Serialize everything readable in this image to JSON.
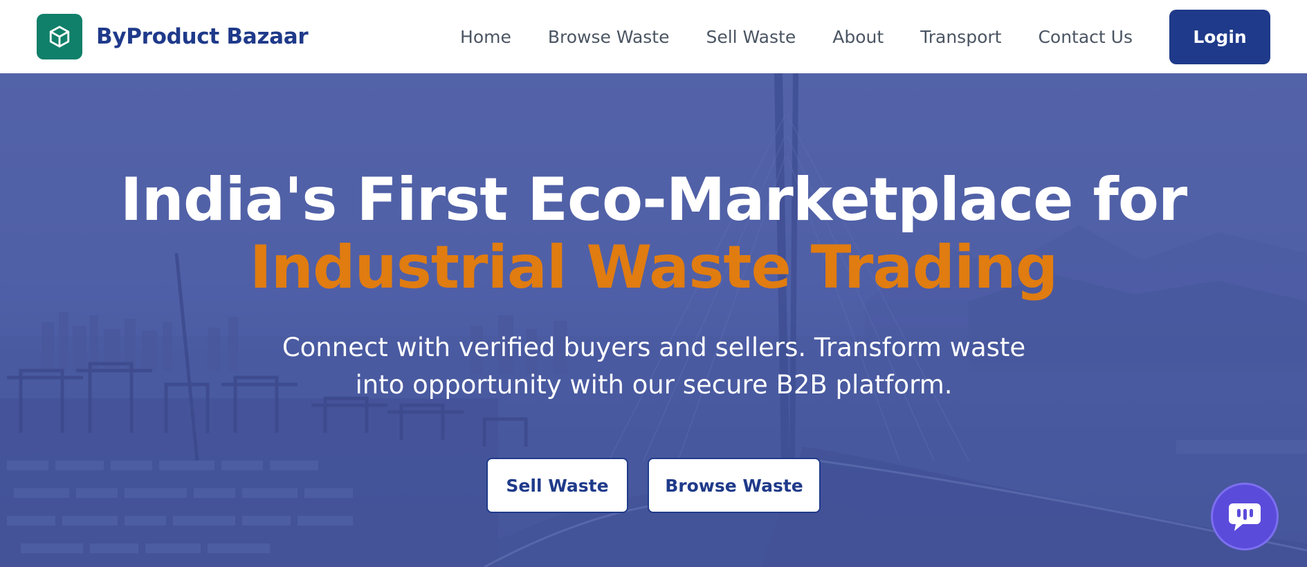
{
  "brand": {
    "name": "ByProduct Bazaar",
    "logo_icon": "cube-icon",
    "logo_color": "#10806a"
  },
  "nav": {
    "links": [
      "Home",
      "Browse Waste",
      "Sell Waste",
      "About",
      "Transport",
      "Contact Us"
    ],
    "login_label": "Login"
  },
  "hero": {
    "title_line1": "India's First Eco-Marketplace for",
    "title_line2": "Industrial Waste Trading",
    "subtitle": "Connect with verified buyers and sellers. Transform waste into opportunity with our secure B2B platform.",
    "sell_button": "Sell Waste",
    "browse_button": "Browse Waste",
    "background": "industrial port with cranes, shipping containers and a cable-stayed bridge"
  },
  "chat": {
    "icon": "chat-bubble-icon"
  },
  "colors": {
    "primary": "#1f3a8a",
    "accent": "#e07c10",
    "brand_green": "#10806a",
    "chat": "#5b4bdb",
    "hero_tint": "#5464a8"
  }
}
